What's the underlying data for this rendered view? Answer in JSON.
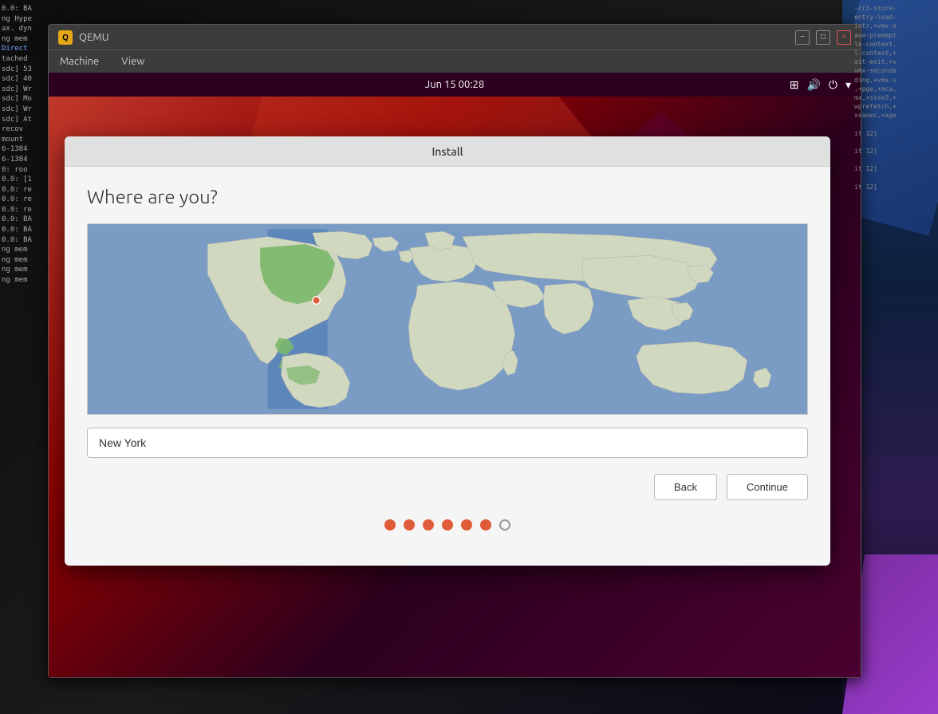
{
  "desktop": {
    "bg": "dark"
  },
  "terminal": {
    "lines": [
      "0.0: BA",
      "ng Hype",
      "ax. dyn",
      "ng mem",
      "Direct",
      "tached",
      "sdc] 53",
      "sdc] 40",
      "sdc] Wr",
      "sdc] Mo",
      "sdc] Wr",
      "sdc] At",
      "recov",
      "mount",
      "6-1384",
      "6-1384",
      "0: roo",
      "0.0: [1",
      "0.0: re",
      "0.0: re",
      "0.0: re",
      "0.0: BA",
      "0.0: BA",
      "0.0: BA",
      "ng mem",
      "ng mem",
      "ng mem",
      "ng mem"
    ]
  },
  "right_terminal": {
    "lines": [
      "-cr3-store-",
      "entry-load-",
      "intr,+vmx-e",
      "ave-preempt",
      "le-context,",
      "l-context,+",
      "ait-exit,+v",
      "vmx-seconda",
      "ding,+vmx-v",
      ",+pge,+mca,",
      "mx,+ssse3,+",
      "wprefetch,+",
      "xsavec,+xge",
      "",
      "it 12]",
      "",
      "it 12]",
      "",
      "it 12]",
      "",
      "it 12]"
    ]
  },
  "qemu": {
    "title": "QEMU",
    "icon": "Q",
    "menu": {
      "machine": "Machine",
      "view": "View"
    },
    "window_controls": {
      "minimize": "−",
      "maximize": "□",
      "close": "×"
    }
  },
  "ubuntu": {
    "topbar": {
      "datetime": "Jun 15  00:28"
    }
  },
  "install_dialog": {
    "title": "Install",
    "heading": "Where are you?",
    "timezone_value": "New York",
    "timezone_placeholder": "New York",
    "buttons": {
      "back": "Back",
      "continue": "Continue"
    },
    "progress_dots": [
      {
        "active": true
      },
      {
        "active": true
      },
      {
        "active": true
      },
      {
        "active": true
      },
      {
        "active": true
      },
      {
        "active": true
      },
      {
        "active": false
      }
    ]
  }
}
